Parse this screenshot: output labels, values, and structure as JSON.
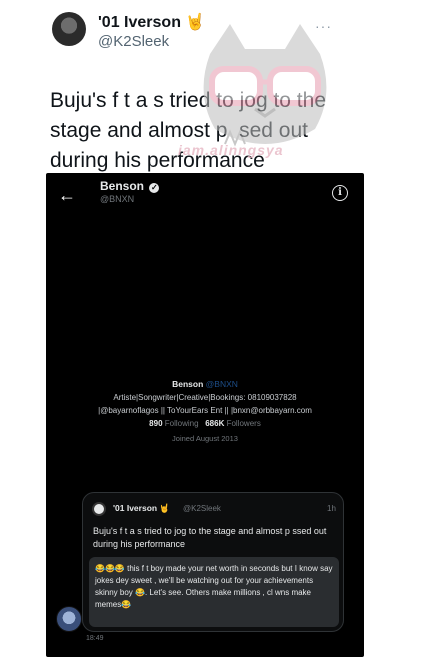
{
  "outer": {
    "name": "'01 Iverson 🤘",
    "handle": "@K2Sleek",
    "more": "···",
    "text": "Buju's f t a s tried to jog to the stage and almost p  sed out during his performance"
  },
  "watermark": {
    "text": "iam.alinngsya"
  },
  "screenshot": {
    "header_title": "Benson",
    "header_handle": "@BNXN",
    "profile": {
      "name": "Benson",
      "handle": "@BNXN",
      "bio_line1": "Artiste|Songwriter|Creative|Bookings: 08109037828",
      "bio_line2": "|@bayarnoflagos || ToYourEars Ent || |bnxn@orbbayarn.com",
      "following_count": "890",
      "following_label": "Following",
      "followers_count": "686K",
      "followers_label": "Followers",
      "joined": "Joined August 2013"
    },
    "quoted": {
      "name": "'01 Iverson 🤘",
      "handle": "@K2Sleek",
      "time": "1h",
      "text": "Buju's f t a s tried to jog to the stage and almost p ssed out during his performance",
      "reply": "😂😂😂 this f t boy made your net worth in seconds but I know say jokes dey sweet , we'll be watching out for your achievements skinny boy 😂. Let's see. Others make millions , cl wns make memes😂"
    },
    "time": "18:49"
  }
}
